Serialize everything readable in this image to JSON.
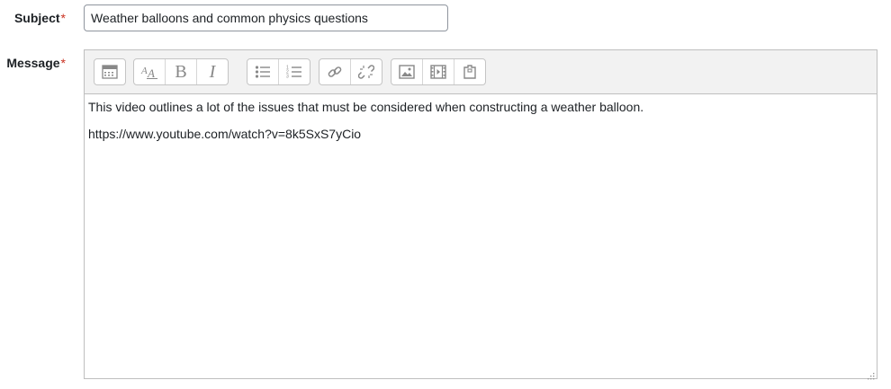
{
  "form": {
    "subject_label": "Subject",
    "message_label": "Message",
    "required_marker": "*",
    "subject_value": "Weather balloons and common physics questions"
  },
  "editor": {
    "toolbar": [
      {
        "group": "collapse",
        "icons": [
          "collapse-toolbar-icon"
        ]
      },
      {
        "group": "style",
        "icons": [
          "font-style-icon",
          "bold-icon",
          "italic-icon"
        ]
      },
      {
        "group": "list",
        "icons": [
          "unordered-list-icon",
          "ordered-list-icon"
        ]
      },
      {
        "group": "links",
        "icons": [
          "link-icon",
          "unlink-icon"
        ]
      },
      {
        "group": "files",
        "icons": [
          "image-icon",
          "media-icon",
          "manage-files-icon"
        ]
      }
    ],
    "bold_glyph": "B",
    "italic_glyph": "I",
    "content": {
      "paragraph_1": "This video outlines a lot of the issues that must be considered when constructing a weather balloon.",
      "paragraph_2": "https://www.youtube.com/watch?v=8k5SxS7yCio"
    }
  },
  "colors": {
    "required": "#ca3120",
    "toolbar_bg": "#f2f2f2",
    "border": "#bfbfbf"
  }
}
